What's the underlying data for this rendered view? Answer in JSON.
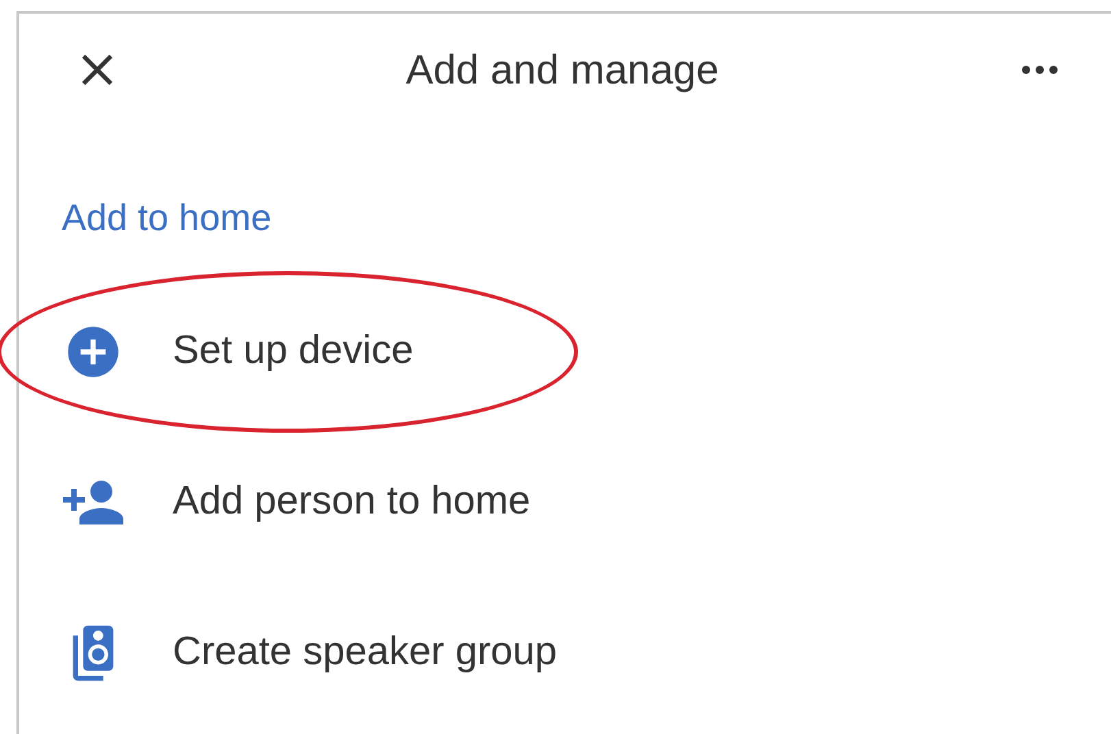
{
  "header": {
    "title": "Add and manage"
  },
  "section": {
    "title": "Add to home"
  },
  "items": [
    {
      "kind": "add",
      "label": "Set up device",
      "highlighted": true
    },
    {
      "kind": "person",
      "label": "Add person to home",
      "highlighted": false
    },
    {
      "kind": "speaker",
      "label": "Create speaker group",
      "highlighted": false
    }
  ]
}
